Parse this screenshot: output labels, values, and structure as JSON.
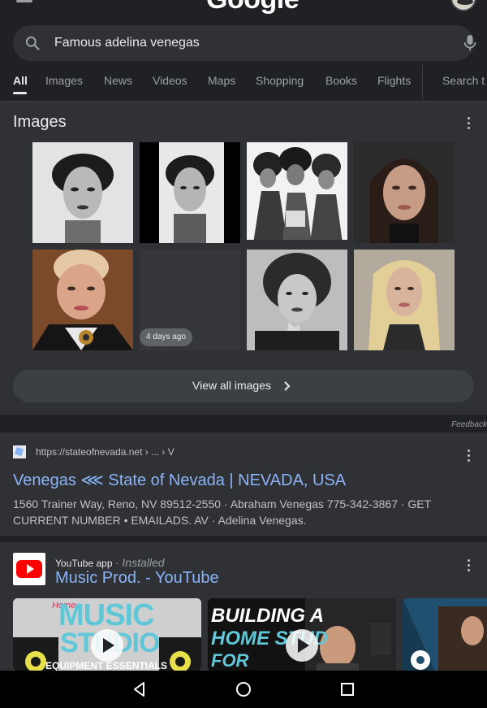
{
  "header": {
    "logo_text": "Google",
    "avatar_icon": "user-avatar-icon",
    "menu_icon": "hamburger-menu-icon"
  },
  "search": {
    "query": "Famous adelina venegas",
    "search_icon": "search-icon",
    "mic_icon": "microphone-icon"
  },
  "tabs": [
    {
      "label": "All",
      "active": true
    },
    {
      "label": "Images"
    },
    {
      "label": "News"
    },
    {
      "label": "Videos"
    },
    {
      "label": "Maps"
    },
    {
      "label": "Shopping"
    },
    {
      "label": "Books"
    },
    {
      "label": "Flights"
    },
    {
      "label": "Search t"
    }
  ],
  "images_section": {
    "title": "Images",
    "date_chip": "4 days ago",
    "view_all_label": "View all images"
  },
  "feedback_label": "Feedback",
  "result": {
    "url": "https://stateofnevada.net › ... › V",
    "title": "Venegas ⋘ State of Nevada | NEVADA, USA",
    "snippet": "1560 Trainer Way, Reno, NV 89512-2550 · Abraham Venegas 775-342-3867 · GET CURRENT NUMBER • EMAILADS. AV · Adelina Venegas."
  },
  "youtube": {
    "source": "YouTube app",
    "installed": "· Installed",
    "title": "Music Prod. - YouTube",
    "videos": [
      {
        "text_top": "MUSIC",
        "text_mid": "STUDIO",
        "text_bottom": "EQUIPMENT ESSENTIALS",
        "script": "Home"
      },
      {
        "text_top": "BUILDING A",
        "text_mid": "HOME STUD",
        "text_bottom": "FOR"
      },
      {
        "text_top": ""
      }
    ]
  },
  "colors": {
    "background": "#202124",
    "card": "#303134",
    "link": "#8ab4f8",
    "text": "#e8eaed",
    "muted": "#9aa0a6"
  },
  "android_nav": {
    "back_icon": "back-triangle-icon",
    "home_icon": "home-circle-icon",
    "recents_icon": "recents-square-icon"
  }
}
